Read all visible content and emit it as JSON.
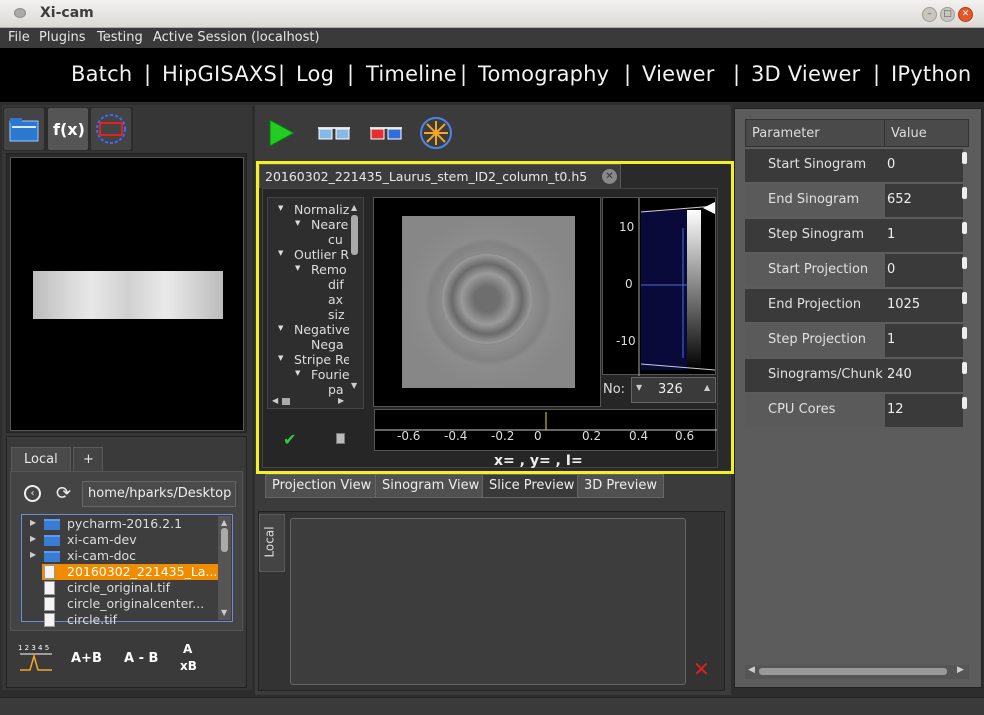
{
  "window": {
    "title": "Xi-cam"
  },
  "menu": [
    "File",
    "Plugins",
    "Testing",
    "Active Session (localhost)"
  ],
  "nav": [
    "Batch",
    "HipGISAXS",
    "Log",
    "Timeline",
    "Tomography",
    "Viewer",
    "3D Viewer",
    "IPython"
  ],
  "left": {
    "fx_label": "f(x)",
    "tabs": [
      "Local",
      "+"
    ],
    "path": "home/hparks/Desktop",
    "files": [
      {
        "name": "pycharm-2016.2.1",
        "type": "folder"
      },
      {
        "name": "xi-cam-dev",
        "type": "folder"
      },
      {
        "name": "xi-cam-doc",
        "type": "folder"
      },
      {
        "name": "20160302_221435_La...",
        "type": "file",
        "selected": true
      },
      {
        "name": "circle_original.tif",
        "type": "file"
      },
      {
        "name": "circle_originalcenter...",
        "type": "file"
      },
      {
        "name": "circle.tif",
        "type": "file"
      }
    ],
    "tools": {
      "spectrum": "1 2 3 4 5",
      "add": "A+B",
      "sub": "A - B",
      "mul_a": "A",
      "mul_b": "xB"
    }
  },
  "center": {
    "doc_tab": "20160302_221435_Laurus_stem_ID2_column_t0.h5",
    "tree": [
      {
        "label": "Normaliz",
        "indent": 0,
        "arrow": true
      },
      {
        "label": "Neare",
        "indent": 1,
        "arrow": true
      },
      {
        "label": "cu",
        "indent": 2,
        "arrow": false
      },
      {
        "label": "Outlier R",
        "indent": 0,
        "arrow": true
      },
      {
        "label": "Remo",
        "indent": 1,
        "arrow": true
      },
      {
        "label": "dif",
        "indent": 2,
        "arrow": false
      },
      {
        "label": "ax",
        "indent": 2,
        "arrow": false
      },
      {
        "label": "siz",
        "indent": 2,
        "arrow": false
      },
      {
        "label": "Negative",
        "indent": 0,
        "arrow": true
      },
      {
        "label": "Nega",
        "indent": 1,
        "arrow": false
      },
      {
        "label": "Stripe Re",
        "indent": 0,
        "arrow": true
      },
      {
        "label": "Fourie",
        "indent": 1,
        "arrow": true
      },
      {
        "label": "pa",
        "indent": 2,
        "arrow": false
      }
    ],
    "histogram_ticks": [
      "10",
      "0",
      "-10"
    ],
    "no_label": "No:",
    "no_value": "326",
    "xaxis_ticks": [
      "-0.6",
      "-0.4",
      "-0.2",
      "0",
      "0.2",
      "0.4",
      "0.6"
    ],
    "coords": "x= , y= , I=",
    "bottom_tabs": [
      "Projection View",
      "Sinogram View",
      "Slice Preview",
      "3D Preview"
    ],
    "log_tab": "Local"
  },
  "params": {
    "header": [
      "Parameter",
      "Value"
    ],
    "rows": [
      {
        "name": "Start Sinogram",
        "value": "0"
      },
      {
        "name": "End Sinogram",
        "value": "652"
      },
      {
        "name": "Step Sinogram",
        "value": "1"
      },
      {
        "name": "Start Projection",
        "value": "0"
      },
      {
        "name": "End Projection",
        "value": "1025"
      },
      {
        "name": "Step Projection",
        "value": "1"
      },
      {
        "name": "Sinograms/Chunk",
        "value": "240"
      },
      {
        "name": "CPU Cores",
        "value": "12"
      }
    ]
  },
  "colors": {
    "highlight": "#f4f024",
    "selected_file": "#f08c00",
    "play": "#22cc22",
    "close_x": "#e02020"
  }
}
